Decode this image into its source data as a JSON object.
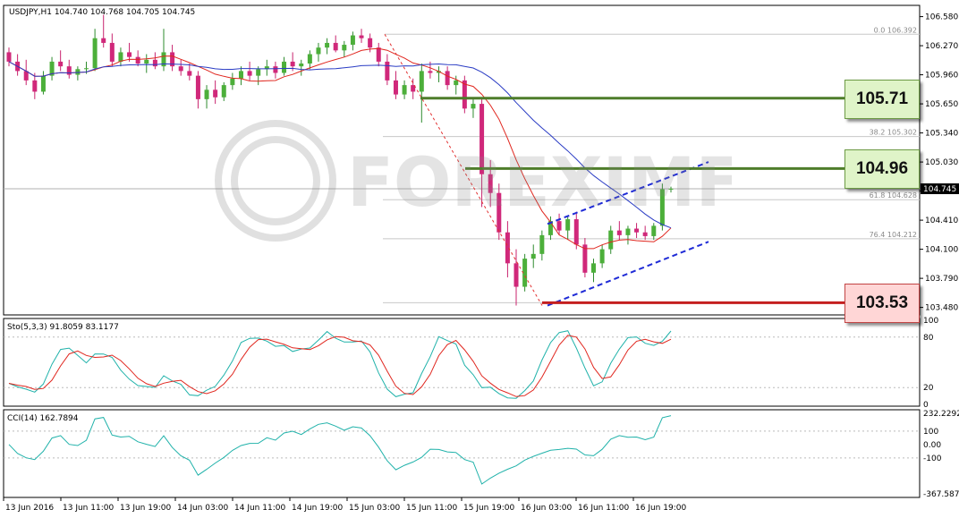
{
  "chart_data": {
    "type": "candlestick",
    "header": "USDJPY,H1  104.740 104.768 104.705 104.745",
    "y_ticks": [
      "106.580",
      "106.270",
      "105.960",
      "105.650",
      "105.340",
      "105.030",
      "104.720",
      "104.410",
      "104.100",
      "103.790",
      "103.480"
    ],
    "ylim": [
      103.4,
      106.7
    ],
    "x_ticks": [
      "13 Jun 2016",
      "13 Jun 11:00",
      "13 Jun 19:00",
      "14 Jun 03:00",
      "14 Jun 11:00",
      "14 Jun 19:00",
      "15 Jun 03:00",
      "15 Jun 11:00",
      "15 Jun 19:00",
      "16 Jun 03:00",
      "16 Jun 11:00",
      "16 Jun 19:00"
    ],
    "current_price": "104.745",
    "fib_levels": [
      {
        "label": "0.0  106.392",
        "value": 106.392
      },
      {
        "label": "38.2 105.302",
        "value": 105.302
      },
      {
        "label": "61.8 104.628",
        "value": 104.628
      },
      {
        "label": "76.4 104.212",
        "value": 104.212
      }
    ],
    "levels": [
      {
        "label": "105.71",
        "value": 105.71,
        "color": "#4e7d2a",
        "kind": "resistance"
      },
      {
        "label": "104.96",
        "value": 104.96,
        "color": "#4e7d2a",
        "kind": "resistance"
      },
      {
        "label": "103.53",
        "value": 103.53,
        "color": "#c41f1f",
        "kind": "support"
      }
    ],
    "candles": [
      [
        106.2,
        106.25,
        106.05,
        106.1
      ],
      [
        106.1,
        106.18,
        105.95,
        106.0
      ],
      [
        106.0,
        106.12,
        105.85,
        105.9
      ],
      [
        105.9,
        105.98,
        105.7,
        105.78
      ],
      [
        105.78,
        106.0,
        105.75,
        105.95
      ],
      [
        105.95,
        106.15,
        105.9,
        106.1
      ],
      [
        106.1,
        106.22,
        106.0,
        106.05
      ],
      [
        106.05,
        106.12,
        105.92,
        105.96
      ],
      [
        105.96,
        106.05,
        105.9,
        106.02
      ],
      [
        106.02,
        106.1,
        105.97,
        106.03
      ],
      [
        106.03,
        106.45,
        106.0,
        106.35
      ],
      [
        106.35,
        106.6,
        106.25,
        106.3
      ],
      [
        106.3,
        106.4,
        106.05,
        106.1
      ],
      [
        106.1,
        106.25,
        106.05,
        106.2
      ],
      [
        106.2,
        106.3,
        106.1,
        106.15
      ],
      [
        106.15,
        106.22,
        106.05,
        106.08
      ],
      [
        106.08,
        106.18,
        105.98,
        106.12
      ],
      [
        106.12,
        106.2,
        106.02,
        106.05
      ],
      [
        106.05,
        106.45,
        106.0,
        106.2
      ],
      [
        106.2,
        106.28,
        106.0,
        106.05
      ],
      [
        106.05,
        106.12,
        105.95,
        106.0
      ],
      [
        106.0,
        106.08,
        105.9,
        105.95
      ],
      [
        105.95,
        106.0,
        105.6,
        105.7
      ],
      [
        105.7,
        105.85,
        105.6,
        105.8
      ],
      [
        105.8,
        105.9,
        105.65,
        105.72
      ],
      [
        105.72,
        105.88,
        105.68,
        105.85
      ],
      [
        105.85,
        105.98,
        105.8,
        105.92
      ],
      [
        105.92,
        106.05,
        105.85,
        106.0
      ],
      [
        106.0,
        106.1,
        105.9,
        105.95
      ],
      [
        105.95,
        106.05,
        105.85,
        106.02
      ],
      [
        106.02,
        106.12,
        105.95,
        106.05
      ],
      [
        106.05,
        106.1,
        105.92,
        105.98
      ],
      [
        105.98,
        106.15,
        105.95,
        106.1
      ],
      [
        106.1,
        106.2,
        106.0,
        106.05
      ],
      [
        106.05,
        106.12,
        105.95,
        106.08
      ],
      [
        106.08,
        106.22,
        106.02,
        106.18
      ],
      [
        106.18,
        106.3,
        106.1,
        106.25
      ],
      [
        106.25,
        106.35,
        106.18,
        106.3
      ],
      [
        106.3,
        106.38,
        106.2,
        106.22
      ],
      [
        106.22,
        106.32,
        106.15,
        106.28
      ],
      [
        106.28,
        106.42,
        106.22,
        106.38
      ],
      [
        106.38,
        106.45,
        106.3,
        106.35
      ],
      [
        106.35,
        106.4,
        106.2,
        106.25
      ],
      [
        106.25,
        106.3,
        106.05,
        106.1
      ],
      [
        106.1,
        106.18,
        105.85,
        105.9
      ],
      [
        105.9,
        106.0,
        105.7,
        105.75
      ],
      [
        105.75,
        105.9,
        105.7,
        105.85
      ],
      [
        105.85,
        105.92,
        105.7,
        105.78
      ],
      [
        105.78,
        106.08,
        105.45,
        106.0
      ],
      [
        106.0,
        106.1,
        105.92,
        105.98
      ],
      [
        105.98,
        106.05,
        105.88,
        106.0
      ],
      [
        106.0,
        106.05,
        105.8,
        105.85
      ],
      [
        105.85,
        105.95,
        105.75,
        105.9
      ],
      [
        105.9,
        105.95,
        105.55,
        105.6
      ],
      [
        105.6,
        105.7,
        105.5,
        105.65
      ],
      [
        105.65,
        105.7,
        104.55,
        104.9
      ],
      [
        104.9,
        105.05,
        104.55,
        104.7
      ],
      [
        104.7,
        104.8,
        104.2,
        104.28
      ],
      [
        104.28,
        104.4,
        103.8,
        103.95
      ],
      [
        103.95,
        104.1,
        103.5,
        103.7
      ],
      [
        103.7,
        104.05,
        103.65,
        104.0
      ],
      [
        104.0,
        104.15,
        103.9,
        104.05
      ],
      [
        104.05,
        104.3,
        103.98,
        104.25
      ],
      [
        104.25,
        104.45,
        104.2,
        104.4
      ],
      [
        104.4,
        104.48,
        104.25,
        104.3
      ],
      [
        104.3,
        104.45,
        104.2,
        104.42
      ],
      [
        104.42,
        104.5,
        104.1,
        104.15
      ],
      [
        104.15,
        104.22,
        103.8,
        103.85
      ],
      [
        103.85,
        104.0,
        103.75,
        103.95
      ],
      [
        103.95,
        104.15,
        103.9,
        104.1
      ],
      [
        104.1,
        104.35,
        104.05,
        104.3
      ],
      [
        104.3,
        104.4,
        104.2,
        104.25
      ],
      [
        104.25,
        104.35,
        104.15,
        104.32
      ],
      [
        104.32,
        104.38,
        104.22,
        104.28
      ],
      [
        104.28,
        104.35,
        104.2,
        104.24
      ],
      [
        104.24,
        104.38,
        104.2,
        104.35
      ],
      [
        104.35,
        104.8,
        104.3,
        104.74
      ],
      [
        104.74,
        104.768,
        104.705,
        104.745
      ]
    ],
    "stochastic": {
      "label": "Sto(5,3,3) 91.8059 83.1177",
      "ticks": [
        "100",
        "80",
        "20",
        "0"
      ]
    },
    "cci": {
      "label": "CCI(14) 162.7894",
      "ticks": [
        "232.2292",
        "100",
        "0.00",
        "-100",
        "-367.5878"
      ]
    },
    "watermark": "FOREXIMF.COM"
  }
}
